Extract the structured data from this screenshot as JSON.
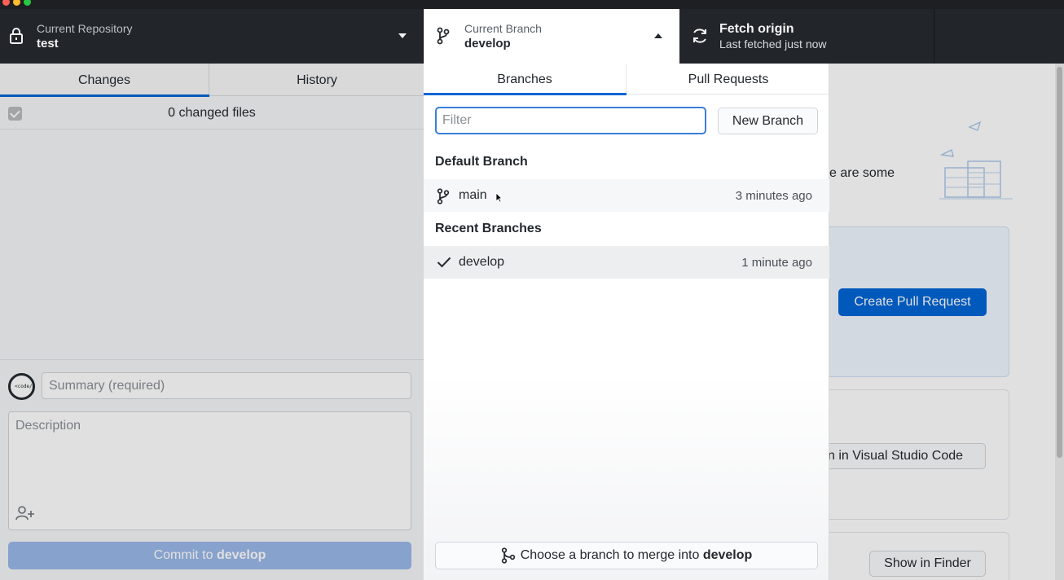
{
  "toolbar": {
    "repo_label": "Current Repository",
    "repo_value": "test",
    "branch_label": "Current Branch",
    "branch_value": "develop",
    "fetch_label": "Fetch origin",
    "fetch_sub": "Last fetched just now"
  },
  "sidebar": {
    "tabs": [
      {
        "label": "Changes"
      },
      {
        "label": "History"
      }
    ],
    "changed_files": "0 changed files",
    "summary_placeholder": "Summary (required)",
    "description_placeholder": "Description",
    "commit_prefix": "Commit to ",
    "commit_branch": "develop",
    "avatar_text": "<code/>"
  },
  "popover": {
    "tabs": [
      {
        "label": "Branches"
      },
      {
        "label": "Pull Requests"
      }
    ],
    "filter_placeholder": "Filter",
    "new_branch_label": "New Branch",
    "default_header": "Default Branch",
    "recent_header": "Recent Branches",
    "default_branches": [
      {
        "name": "main",
        "time": "3 minutes ago"
      }
    ],
    "recent_branches": [
      {
        "name": "develop",
        "time": "1 minute ago",
        "checked": true
      }
    ],
    "merge_prefix": "Choose a branch to merge into ",
    "merge_branch": "develop"
  },
  "main": {
    "partial_text": "e are some",
    "create_pr_label": "Create Pull Request",
    "vscode_label": "n in Visual Studio Code",
    "finder_label": "Show in Finder"
  },
  "colors": {
    "accent": "#0366d6",
    "toolbar_bg": "#24292e",
    "filter_focus": "#3b7fd8"
  }
}
